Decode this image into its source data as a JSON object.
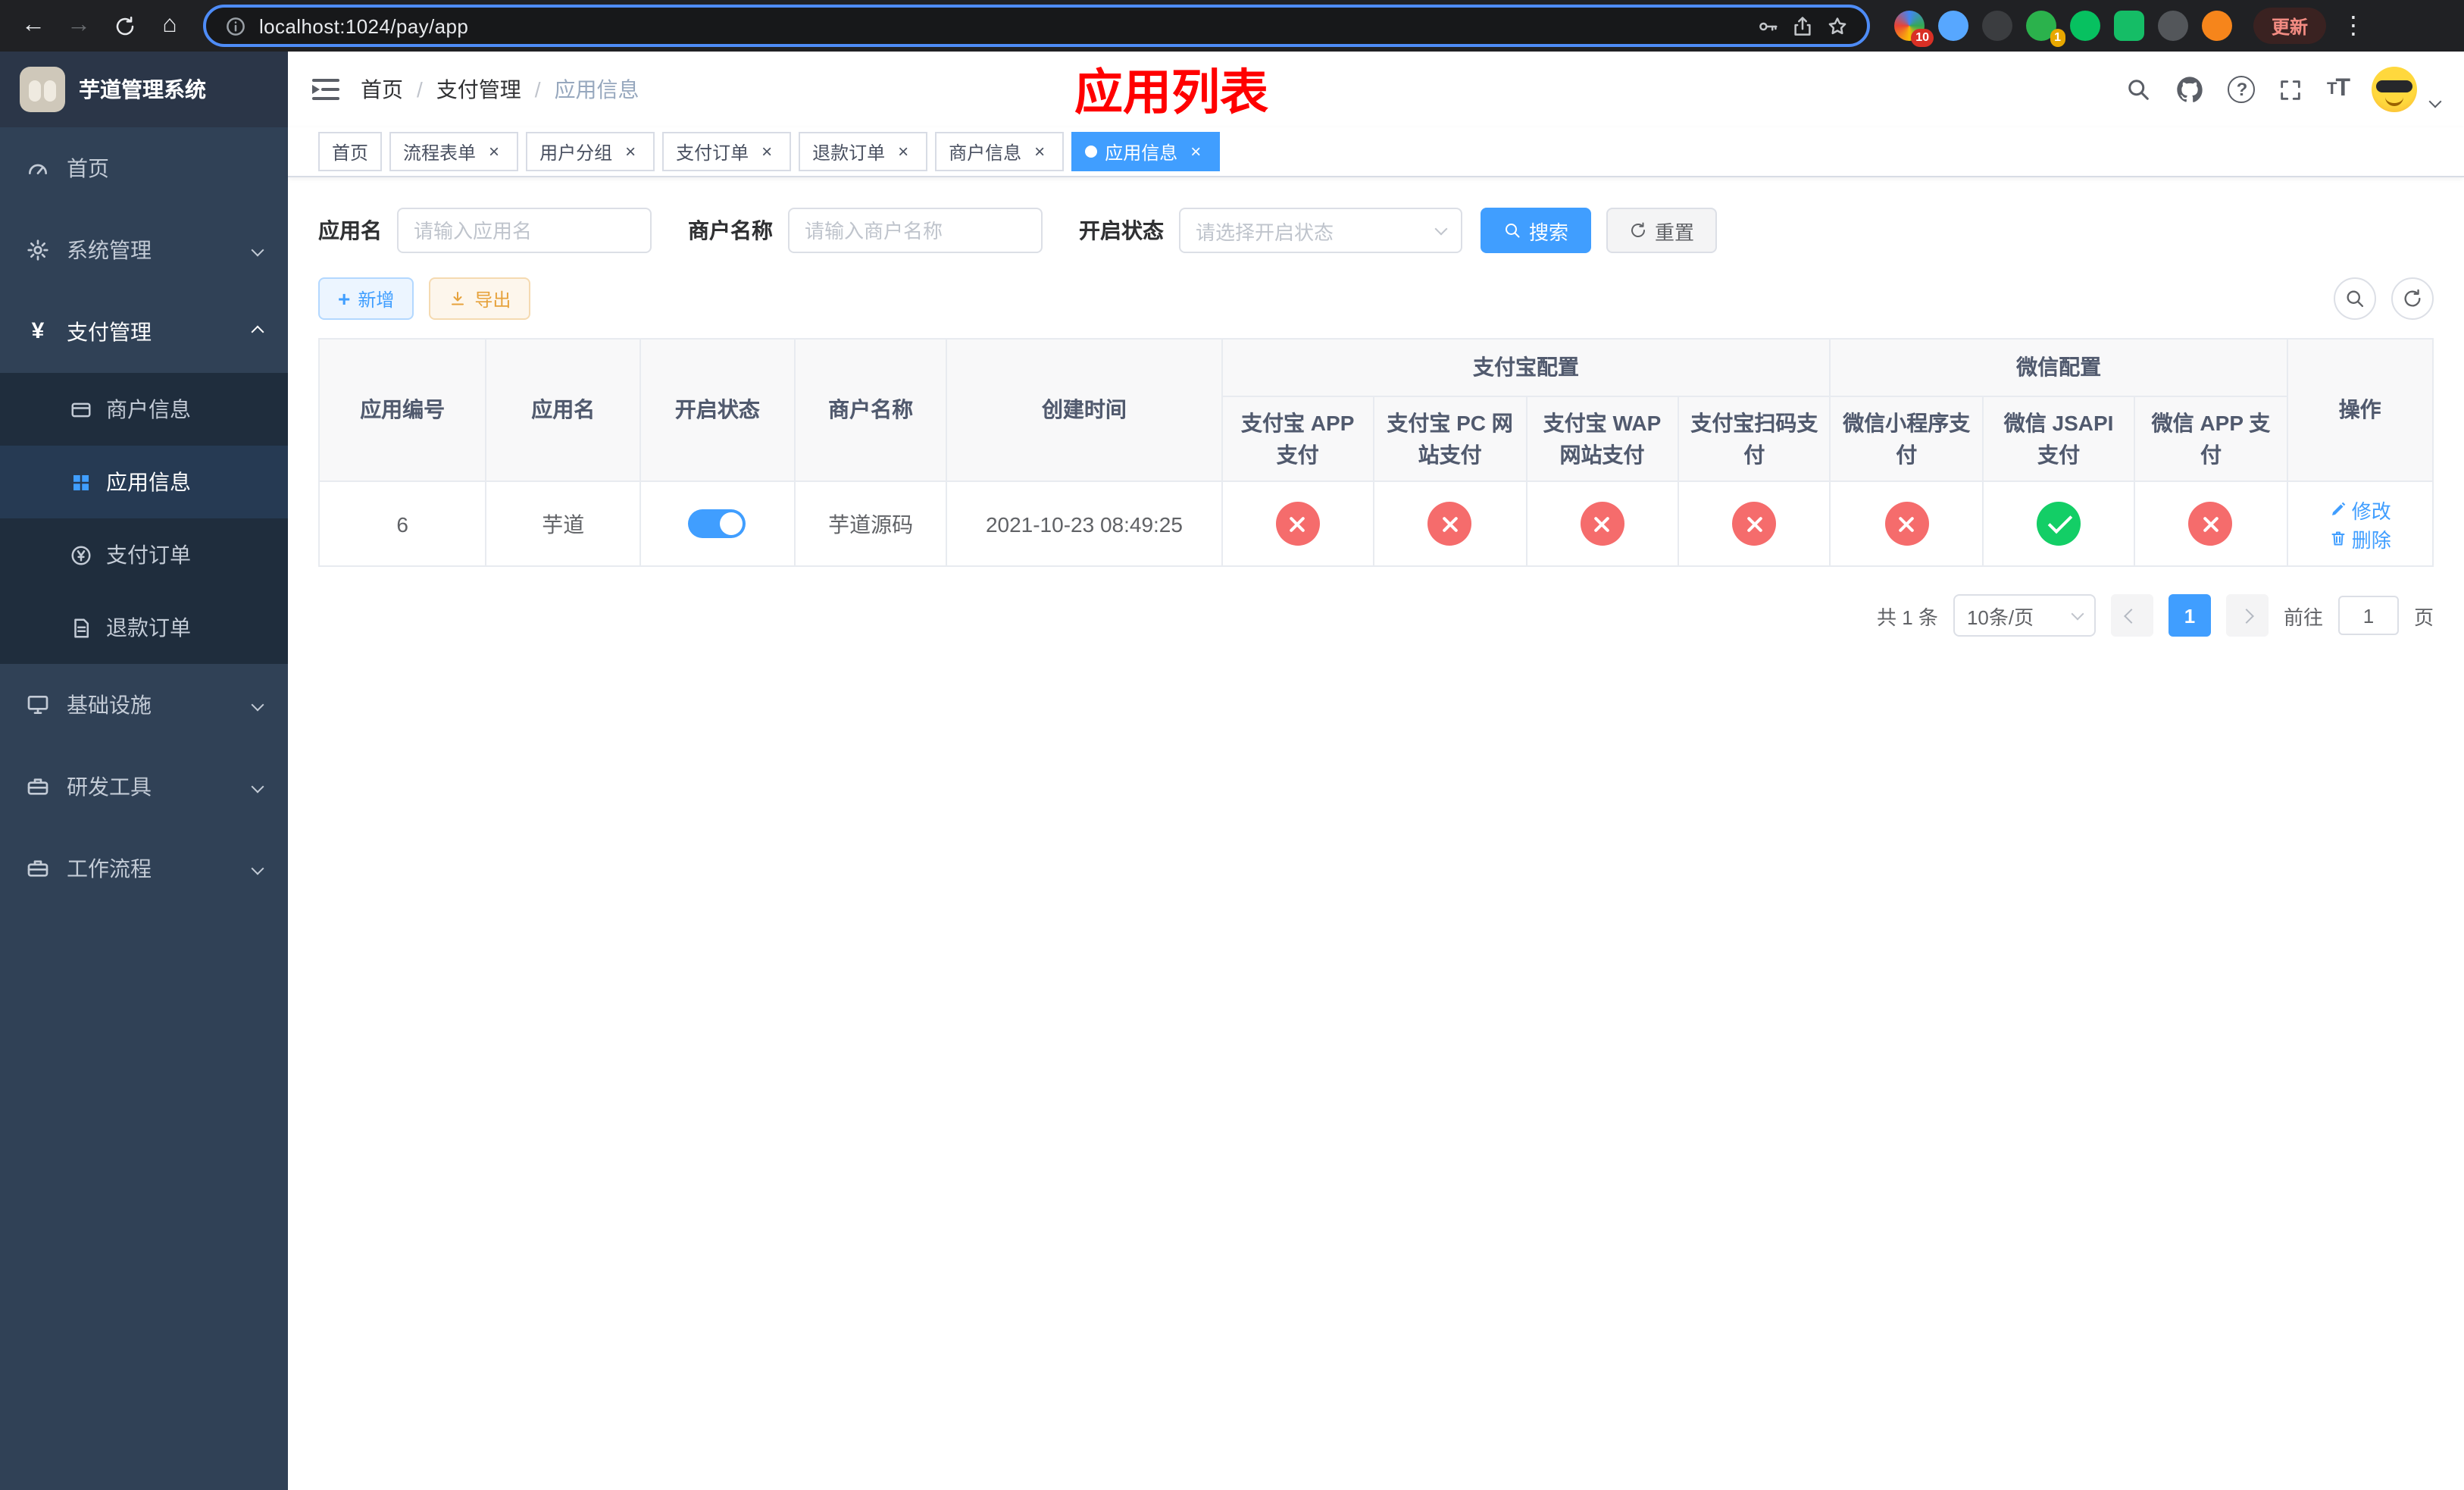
{
  "browser": {
    "url": "localhost:1024/pay/app",
    "update_label": "更新",
    "ext_badge_blue": "10",
    "ext_badge_green": "1"
  },
  "sidebar": {
    "title": "芋道管理系统",
    "items": {
      "home": "首页",
      "system": "系统管理",
      "payment": "支付管理",
      "infra": "基础设施",
      "devtools": "研发工具",
      "workflow": "工作流程"
    },
    "payment_children": {
      "merchant": "商户信息",
      "app": "应用信息",
      "pay_order": "支付订单",
      "refund_order": "退款订单"
    }
  },
  "navbar": {
    "breadcrumb": {
      "home": "首页",
      "payment": "支付管理",
      "current": "应用信息"
    },
    "page_title": "应用列表"
  },
  "tabs": [
    {
      "label": "首页",
      "closable": false,
      "active": false
    },
    {
      "label": "流程表单",
      "closable": true,
      "active": false
    },
    {
      "label": "用户分组",
      "closable": true,
      "active": false
    },
    {
      "label": "支付订单",
      "closable": true,
      "active": false
    },
    {
      "label": "退款订单",
      "closable": true,
      "active": false
    },
    {
      "label": "商户信息",
      "closable": true,
      "active": false
    },
    {
      "label": "应用信息",
      "closable": true,
      "active": true
    }
  ],
  "filters": {
    "app_name_label": "应用名",
    "app_name_placeholder": "请输入应用名",
    "merchant_label": "商户名称",
    "merchant_placeholder": "请输入商户名称",
    "status_label": "开启状态",
    "status_placeholder": "请选择开启状态",
    "search_label": "搜索",
    "reset_label": "重置"
  },
  "toolbar": {
    "add_label": "新增",
    "export_label": "导出"
  },
  "table": {
    "group_headers": {
      "alipay": "支付宝配置",
      "wechat": "微信配置"
    },
    "headers": {
      "app_id": "应用编号",
      "app_name": "应用名",
      "status": "开启状态",
      "merchant": "商户名称",
      "created": "创建时间",
      "alipay_app": "支付宝 APP 支付",
      "alipay_pc": "支付宝 PC 网站支付",
      "alipay_wap": "支付宝 WAP 网站支付",
      "alipay_qr": "支付宝扫码支付",
      "wechat_lite": "微信小程序支付",
      "wechat_jsapi": "微信 JSAPI 支付",
      "wechat_app": "微信 APP 支付",
      "actions": "操作"
    },
    "rows": [
      {
        "app_id": "6",
        "app_name": "芋道",
        "enabled": true,
        "merchant": "芋道源码",
        "created": "2021-10-23 08:49:25",
        "configs": [
          false,
          false,
          false,
          false,
          false,
          true,
          false
        ],
        "edit_label": "修改",
        "delete_label": "删除"
      }
    ]
  },
  "pagination": {
    "total": "共 1 条",
    "page_size": "10条/页",
    "page": "1",
    "goto_label": "前往",
    "goto_value": "1",
    "goto_unit": "页"
  },
  "colors": {
    "primary": "#409eff",
    "danger": "#f56c6c",
    "success": "#13ce66",
    "title_red": "#ff0000",
    "sidebar_bg": "#304156"
  }
}
